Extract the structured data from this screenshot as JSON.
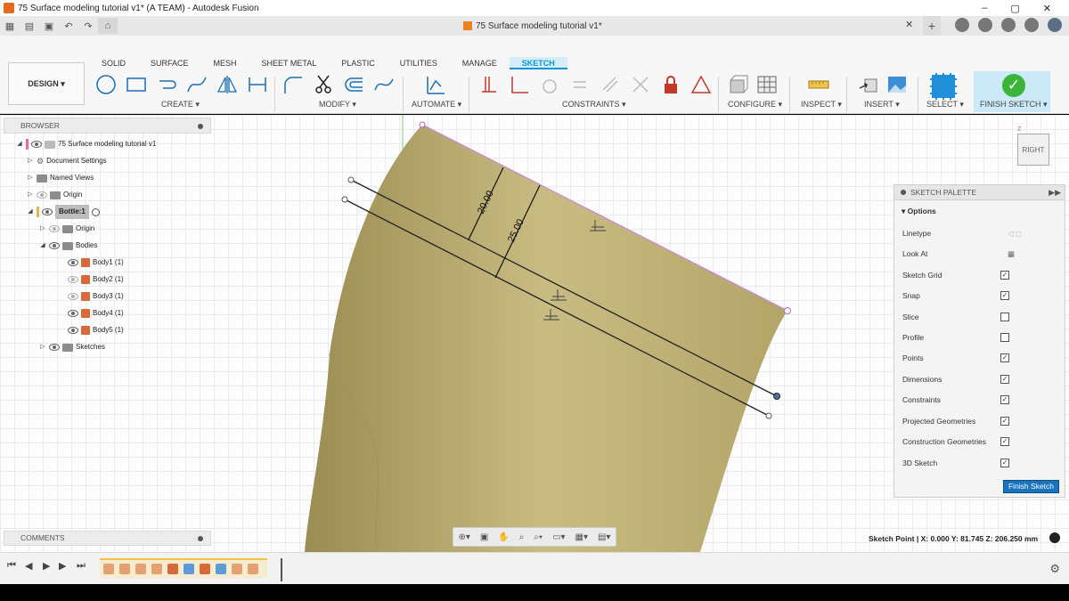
{
  "window": {
    "title": "75 Surface modeling tutorial v1* (A TEAM) - Autodesk Fusion",
    "doc_tab": "75 Surface modeling tutorial v1*"
  },
  "ribbon": {
    "workspace": "DESIGN",
    "tabs": [
      "SOLID",
      "SURFACE",
      "MESH",
      "SHEET METAL",
      "PLASTIC",
      "UTILITIES",
      "MANAGE",
      "SKETCH"
    ],
    "active_tab": "SKETCH",
    "groups": {
      "create": "CREATE",
      "modify": "MODIFY",
      "automate": "AUTOMATE",
      "constraints": "CONSTRAINTS",
      "configure": "CONFIGURE",
      "inspect": "INSPECT",
      "insert": "INSERT",
      "select": "SELECT",
      "finish": "FINISH SKETCH"
    }
  },
  "browser": {
    "title": "BROWSER",
    "items": [
      {
        "label": "75 Surface modeling tutorial v1",
        "level": 0
      },
      {
        "label": "Document Settings",
        "level": 1
      },
      {
        "label": "Named Views",
        "level": 1
      },
      {
        "label": "Origin",
        "level": 1
      },
      {
        "label": "Bottle:1",
        "level": 1
      },
      {
        "label": "Origin",
        "level": 2
      },
      {
        "label": "Bodies",
        "level": 2
      },
      {
        "label": "Body1 (1)",
        "level": 3
      },
      {
        "label": "Body2 (1)",
        "level": 3
      },
      {
        "label": "Body3 (1)",
        "level": 3
      },
      {
        "label": "Body4 (1)",
        "level": 3
      },
      {
        "label": "Body5 (1)",
        "level": 3
      },
      {
        "label": "Sketches",
        "level": 2
      }
    ]
  },
  "comments": {
    "title": "COMMENTS"
  },
  "viewport": {
    "dimensions": [
      "20.00",
      "25.00"
    ],
    "navcube_face": "RIGHT",
    "navcube_axis": "Z"
  },
  "palette": {
    "title": "SKETCH PALETTE",
    "section": "Options",
    "rows": [
      {
        "label": "Linetype",
        "checked": null
      },
      {
        "label": "Look At",
        "checked": null
      },
      {
        "label": "Sketch Grid",
        "checked": true
      },
      {
        "label": "Snap",
        "checked": true
      },
      {
        "label": "Slice",
        "checked": false
      },
      {
        "label": "Profile",
        "checked": false
      },
      {
        "label": "Points",
        "checked": true
      },
      {
        "label": "Dimensions",
        "checked": true
      },
      {
        "label": "Constraints",
        "checked": true
      },
      {
        "label": "Projected Geometries",
        "checked": true
      },
      {
        "label": "Construction Geometries",
        "checked": true
      },
      {
        "label": "3D Sketch",
        "checked": true
      }
    ],
    "finish_button": "Finish Sketch"
  },
  "status": {
    "sketch_point": "Sketch Point | X: 0.000 Y: 81.745 Z: 206.250 mm"
  },
  "colors": {
    "accent": "#0696d7",
    "surface": "#c4b77a",
    "finish_green": "#3ab53a"
  }
}
